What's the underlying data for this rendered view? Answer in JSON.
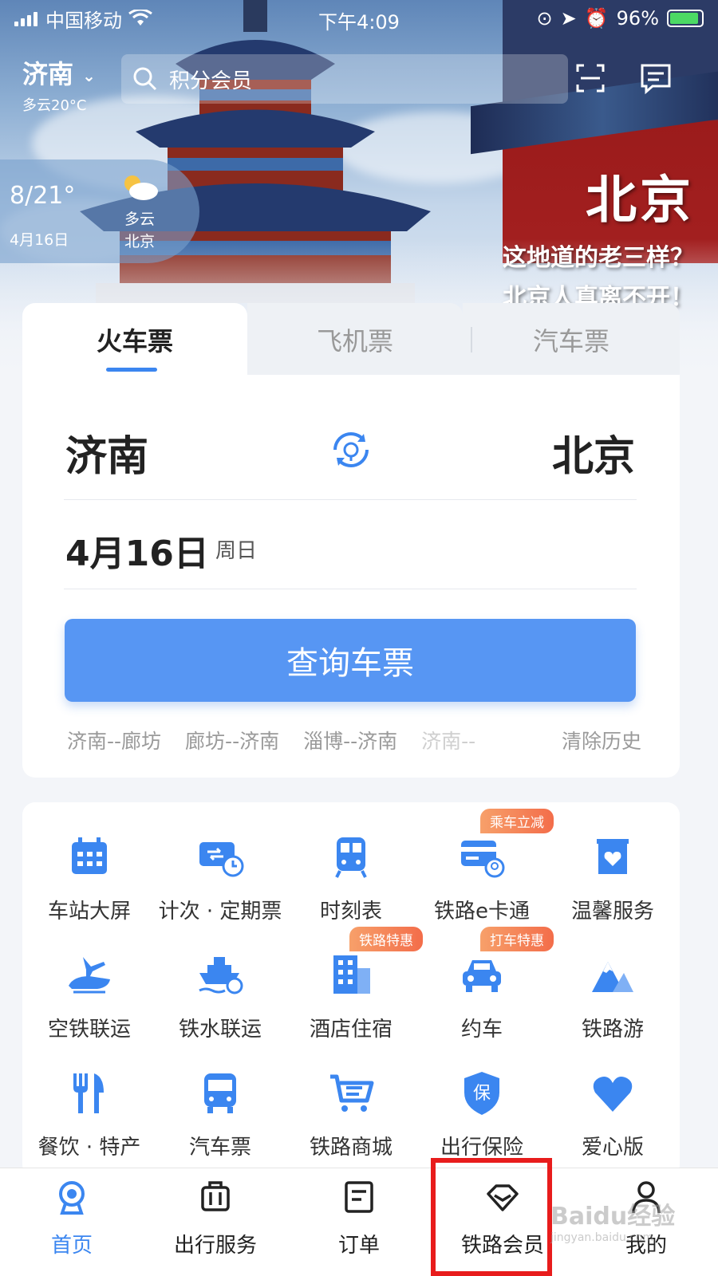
{
  "status": {
    "carrier": "中国移动",
    "time": "下午4:09",
    "battery": "96%"
  },
  "header": {
    "city": "济南",
    "weather": "多云20°C",
    "search_placeholder": "积分会员"
  },
  "weather_card": {
    "temp": "8/21°",
    "date": "4月16日",
    "condition": "多云",
    "city": "北京"
  },
  "promo": {
    "title": "北京",
    "line1": "这地道的老三样？",
    "line2": "北京人真离不开！"
  },
  "tabs": [
    "火车票",
    "飞机票",
    "汽车票"
  ],
  "booking": {
    "from": "济南",
    "to": "北京",
    "date": "4月16日",
    "weekday": "周日",
    "query_label": "查询车票",
    "history": [
      "济南--廊坊",
      "廊坊--济南",
      "淄博--济南",
      "济南--"
    ],
    "clear_label": "清除历史"
  },
  "services": [
    {
      "label": "车站大屏",
      "icon": "calendar-icon",
      "badge": ""
    },
    {
      "label": "计次 · 定期票",
      "icon": "ticket-clock-icon",
      "badge": ""
    },
    {
      "label": "时刻表",
      "icon": "train-icon",
      "badge": ""
    },
    {
      "label": "铁路e卡通",
      "icon": "card-icon",
      "badge": "乘车立减"
    },
    {
      "label": "温馨服务",
      "icon": "heart-box-icon",
      "badge": ""
    },
    {
      "label": "空铁联运",
      "icon": "plane-train-icon",
      "badge": ""
    },
    {
      "label": "铁水联运",
      "icon": "ship-icon",
      "badge": ""
    },
    {
      "label": "酒店住宿",
      "icon": "hotel-icon",
      "badge": "铁路特惠"
    },
    {
      "label": "约车",
      "icon": "car-icon",
      "badge": "打车特惠"
    },
    {
      "label": "铁路游",
      "icon": "mountain-icon",
      "badge": ""
    },
    {
      "label": "餐饮 · 特产",
      "icon": "food-icon",
      "badge": ""
    },
    {
      "label": "汽车票",
      "icon": "bus-icon",
      "badge": ""
    },
    {
      "label": "铁路商城",
      "icon": "cart-icon",
      "badge": ""
    },
    {
      "label": "出行保险",
      "icon": "shield-icon",
      "badge": ""
    },
    {
      "label": "爱心版",
      "icon": "heart-icon",
      "badge": ""
    }
  ],
  "nav": [
    {
      "label": "首页",
      "icon": "home-rail-icon"
    },
    {
      "label": "出行服务",
      "icon": "luggage-icon"
    },
    {
      "label": "订单",
      "icon": "order-icon"
    },
    {
      "label": "铁路会员",
      "icon": "diamond-icon"
    },
    {
      "label": "我的",
      "icon": "user-icon"
    }
  ],
  "watermark": {
    "brand": "Baidu经验",
    "url": "jingyan.baidu.com"
  },
  "colors": {
    "accent": "#3b86f0",
    "button": "#5796f3",
    "badge": "#f36d4a",
    "highlight": "#e81c1c"
  }
}
